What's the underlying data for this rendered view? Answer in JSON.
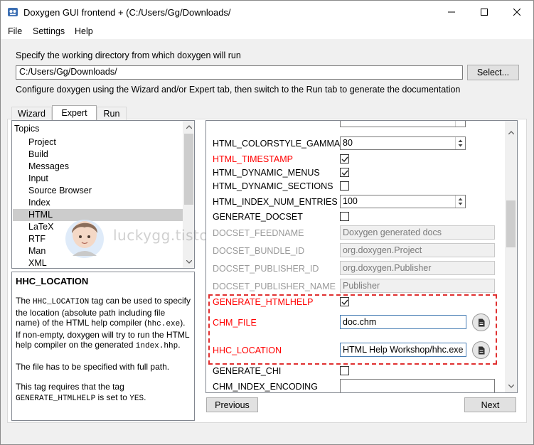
{
  "window": {
    "title": "Doxygen GUI frontend + (C:/Users/Gg/Downloads/",
    "controls": {
      "minimize": "minimize",
      "maximize": "maximize",
      "close": "close"
    }
  },
  "menu": [
    "File",
    "Settings",
    "Help"
  ],
  "workdir": {
    "label": "Specify the working directory from which doxygen will run",
    "value": "C:/Users/Gg/Downloads/",
    "select_label": "Select..."
  },
  "config_hint": "Configure doxygen using the Wizard and/or Expert tab, then switch to the Run tab to generate the documentation",
  "tabs": [
    {
      "label": "Wizard",
      "active": false
    },
    {
      "label": "Expert",
      "active": true
    },
    {
      "label": "Run",
      "active": false
    }
  ],
  "topics": {
    "header": "Topics",
    "items": [
      "Project",
      "Build",
      "Messages",
      "Input",
      "Source Browser",
      "Index",
      "HTML",
      "LaTeX",
      "RTF",
      "Man",
      "XML"
    ],
    "selected": "HTML"
  },
  "help": {
    "title": "HHC_LOCATION",
    "p1_a": "The ",
    "p1_code1": "HHC_LOCATION",
    "p1_b": " tag can be used to specify the location (absolute path including file name) of the HTML help compiler (",
    "p1_code2": "hhc.exe",
    "p1_c": "). If non-empty, doxygen will try to run the HTML help compiler on the generated ",
    "p1_code3": "index.hhp",
    "p1_d": ".",
    "p2": "The file has to be specified with full path.",
    "p3_a": "This tag requires that the tag ",
    "p3_code1": "GENERATE_HTMLHELP",
    "p3_b": " is set to ",
    "p3_code2": "YES",
    "p3_c": "."
  },
  "options": {
    "colorstyle_gamma": {
      "label": "HTML_COLORSTYLE_GAMMA",
      "value": "80"
    },
    "timestamp": {
      "label": "HTML_TIMESTAMP",
      "checked": true
    },
    "dynamic_menus": {
      "label": "HTML_DYNAMIC_MENUS",
      "checked": true
    },
    "dynamic_sections": {
      "label": "HTML_DYNAMIC_SECTIONS",
      "checked": false
    },
    "index_num_entries": {
      "label": "HTML_INDEX_NUM_ENTRIES",
      "value": "100"
    },
    "generate_docset": {
      "label": "GENERATE_DOCSET",
      "checked": false
    },
    "docset_feedname": {
      "label": "DOCSET_FEEDNAME",
      "value": "Doxygen generated docs"
    },
    "docset_bundle_id": {
      "label": "DOCSET_BUNDLE_ID",
      "value": "org.doxygen.Project"
    },
    "docset_publisher_id": {
      "label": "DOCSET_PUBLISHER_ID",
      "value": "org.doxygen.Publisher"
    },
    "docset_publisher_name": {
      "label": "DOCSET_PUBLISHER_NAME",
      "value": "Publisher"
    },
    "generate_htmlhelp": {
      "label": "GENERATE_HTMLHELP",
      "checked": true
    },
    "chm_file": {
      "label": "CHM_FILE",
      "value": "doc.chm"
    },
    "hhc_location": {
      "label": "HHC_LOCATION",
      "value": "HTML Help Workshop/hhc.exe"
    },
    "generate_chi": {
      "label": "GENERATE_CHI",
      "checked": false
    },
    "chm_index_encoding": {
      "label": "CHM_INDEX_ENCODING",
      "value": ""
    }
  },
  "nav": {
    "previous": "Previous",
    "next": "Next"
  },
  "watermark": "luckygg.tistory.com",
  "colors": {
    "highlight_red": "#ff0000",
    "selected_bg": "#cccccc"
  }
}
